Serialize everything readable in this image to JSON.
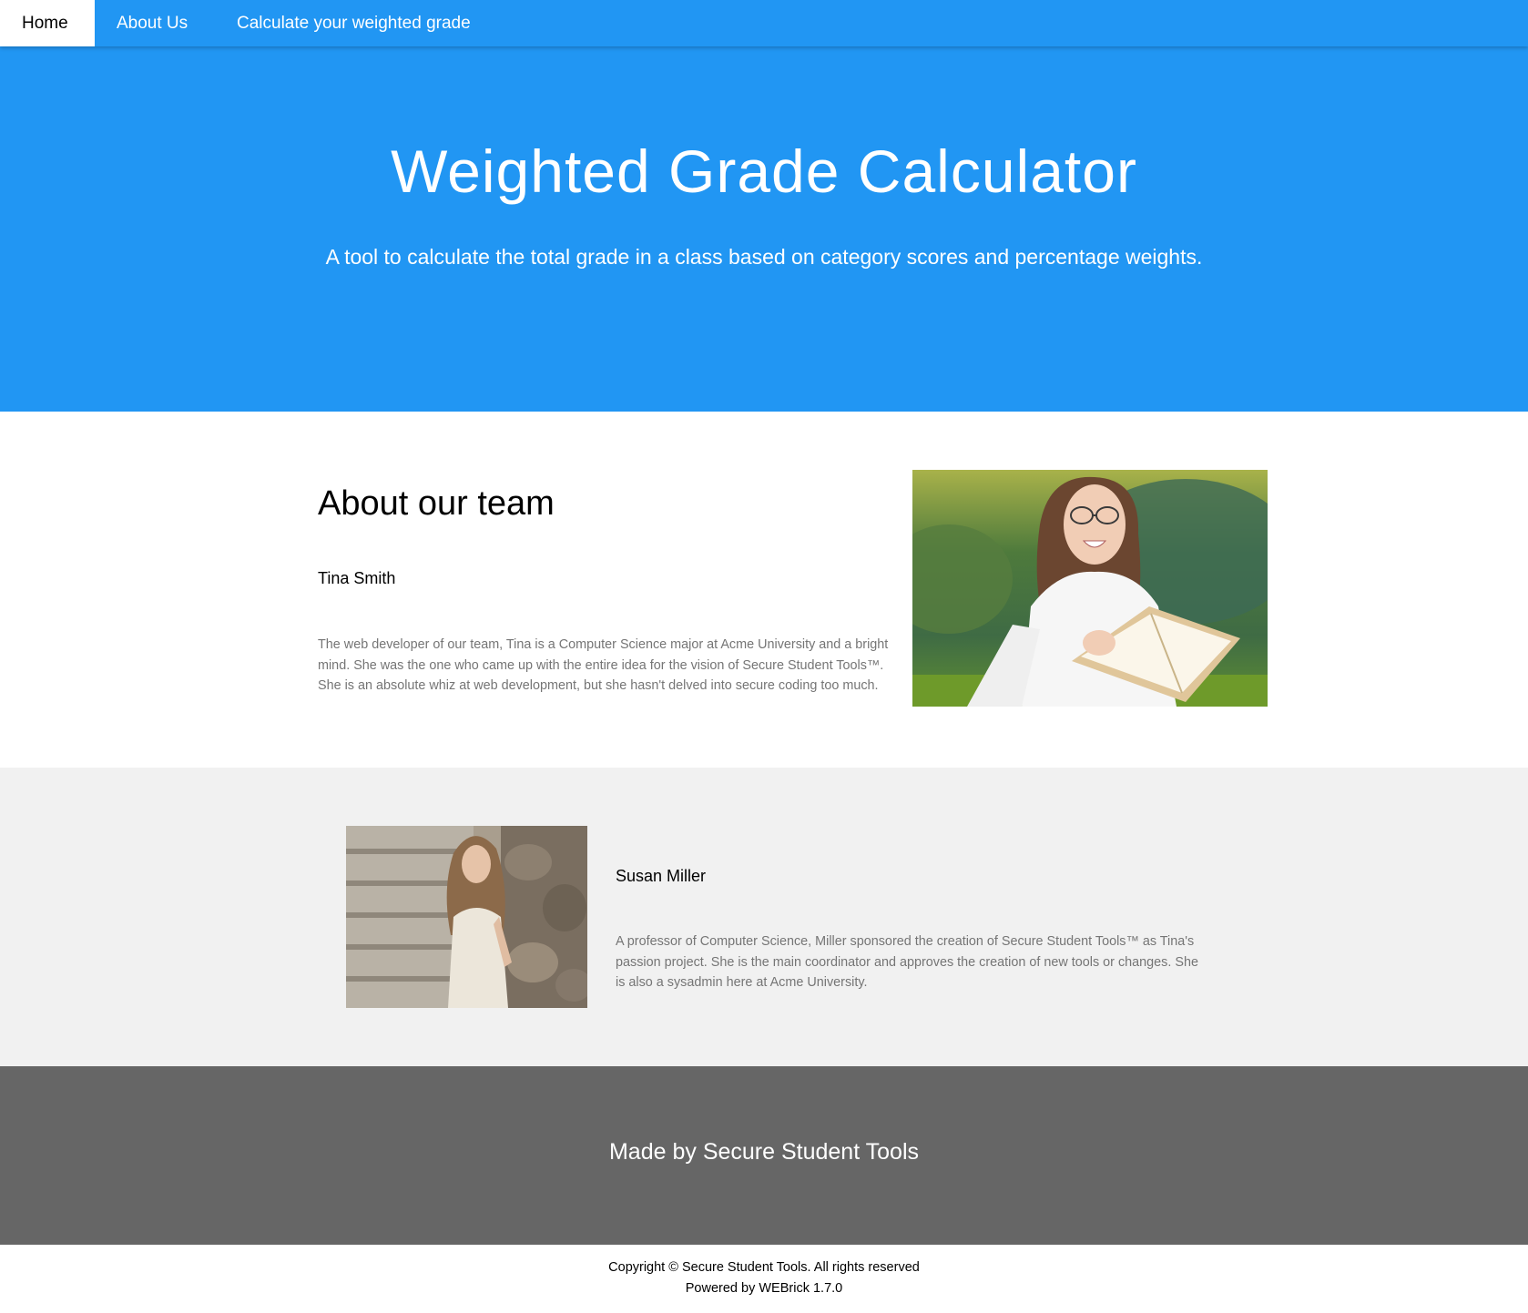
{
  "nav": {
    "items": [
      {
        "label": "Home"
      },
      {
        "label": "About Us"
      },
      {
        "label": "Calculate your weighted grade"
      }
    ]
  },
  "hero": {
    "title": "Weighted Grade Calculator",
    "subtitle": "A tool to calculate the total grade in a class based on category scores and percentage weights."
  },
  "team": {
    "heading": "About our team",
    "members": [
      {
        "name": "Tina Smith",
        "description": "The web developer of our team, Tina is a Computer Science major at Acme University and a bright mind. She was the one who came up with the entire idea for the vision of Secure Student Tools™. She is an absolute whiz at web development, but she hasn't delved into secure coding too much."
      },
      {
        "name": "Susan Miller",
        "description": "A professor of Computer Science, Miller sponsored the creation of Secure Student Tools™ as Tina's passion project. She is the main coordinator and approves the creation of new tools or changes. She is also a sysadmin here at Acme University."
      }
    ]
  },
  "footer": {
    "made_by": "Made by Secure Student Tools",
    "copyright": "Copyright © Secure Student Tools. All rights reserved",
    "powered_by": "Powered by WEBrick 1.7.0"
  },
  "colors": {
    "primary": "#2196f3",
    "section_alt": "#f1f1f1",
    "footer": "#666666",
    "muted_text": "#757575"
  }
}
